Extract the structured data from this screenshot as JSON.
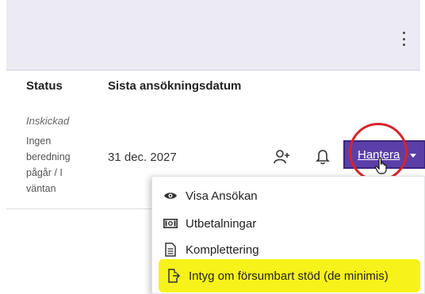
{
  "table": {
    "headers": {
      "status": "Status",
      "date": "Sista ansökningsdatum"
    },
    "row": {
      "status": "Inskickad",
      "status_detail": "Ingen beredning pågår / I väntan",
      "date": "31 dec. 2027"
    }
  },
  "actions": {
    "manage_label": "Hantera"
  },
  "menu": {
    "items": [
      {
        "label": "Visa Ansökan",
        "icon": "eye-icon"
      },
      {
        "label": "Utbetalningar",
        "icon": "money-icon"
      },
      {
        "label": "Komplettering",
        "icon": "document-icon"
      },
      {
        "label": "Intyg om försumbart stöd (de minimis)",
        "icon": "export-icon"
      }
    ]
  },
  "colors": {
    "accent": "#5b3fa8",
    "highlight": "#f7f219",
    "annotation_circle": "#d9232b",
    "topbar": "#ecebf4"
  }
}
